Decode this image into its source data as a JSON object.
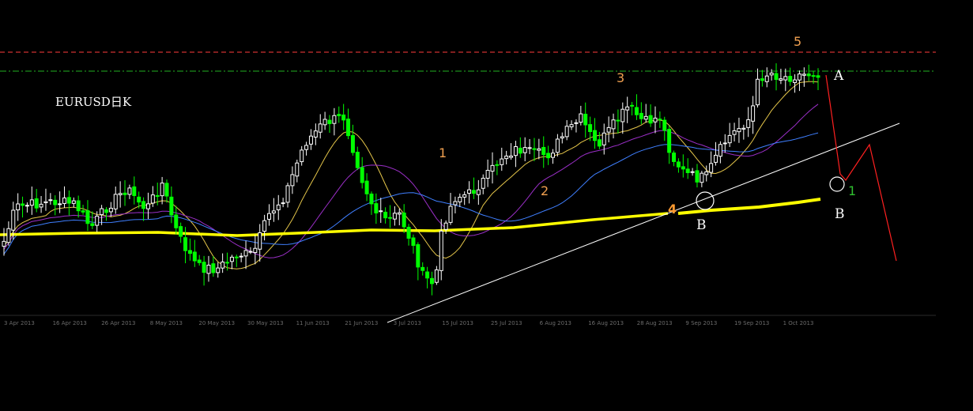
{
  "chart_data": {
    "type": "candlestick",
    "title": "EURUSD日K",
    "x_labels": [
      "3 Apr 2013",
      "16 Apr 2013",
      "26 Apr 2013",
      "8 May 2013",
      "20 May 2013",
      "30 May 2013",
      "11 Jun 2013",
      "21 Jun 2013",
      "3 Jul 2013",
      "15 Jul 2013",
      "25 Jul 2013",
      "6 Aug 2013",
      "16 Aug 2013",
      "28 Aug 2013",
      "9 Sep 2013",
      "19 Sep 2013",
      "1 Oct 2013"
    ],
    "annotations": {
      "wave_labels": [
        "1",
        "2",
        "3",
        "4",
        "5"
      ],
      "projection_label": "1",
      "letter_a": "A",
      "letter_b": "B",
      "letter_b_projection": "B"
    },
    "colors": {
      "background": "#000000",
      "candle_up": "#ffffff",
      "candle_down": "#00ff00",
      "ma_fast": "#e5c64a",
      "ma_mid": "#9b2fc8",
      "ma_slow": "#3f7fff",
      "ma_long": "#ffff00",
      "resistance_line": "#ff3b3b",
      "support_line": "#22b022",
      "trend_line": "#ffffff",
      "projection_line": "#ff2020",
      "wave_label": "#f0a050",
      "projection_label_color": "#30c030"
    },
    "grid": false,
    "legend": "none"
  }
}
